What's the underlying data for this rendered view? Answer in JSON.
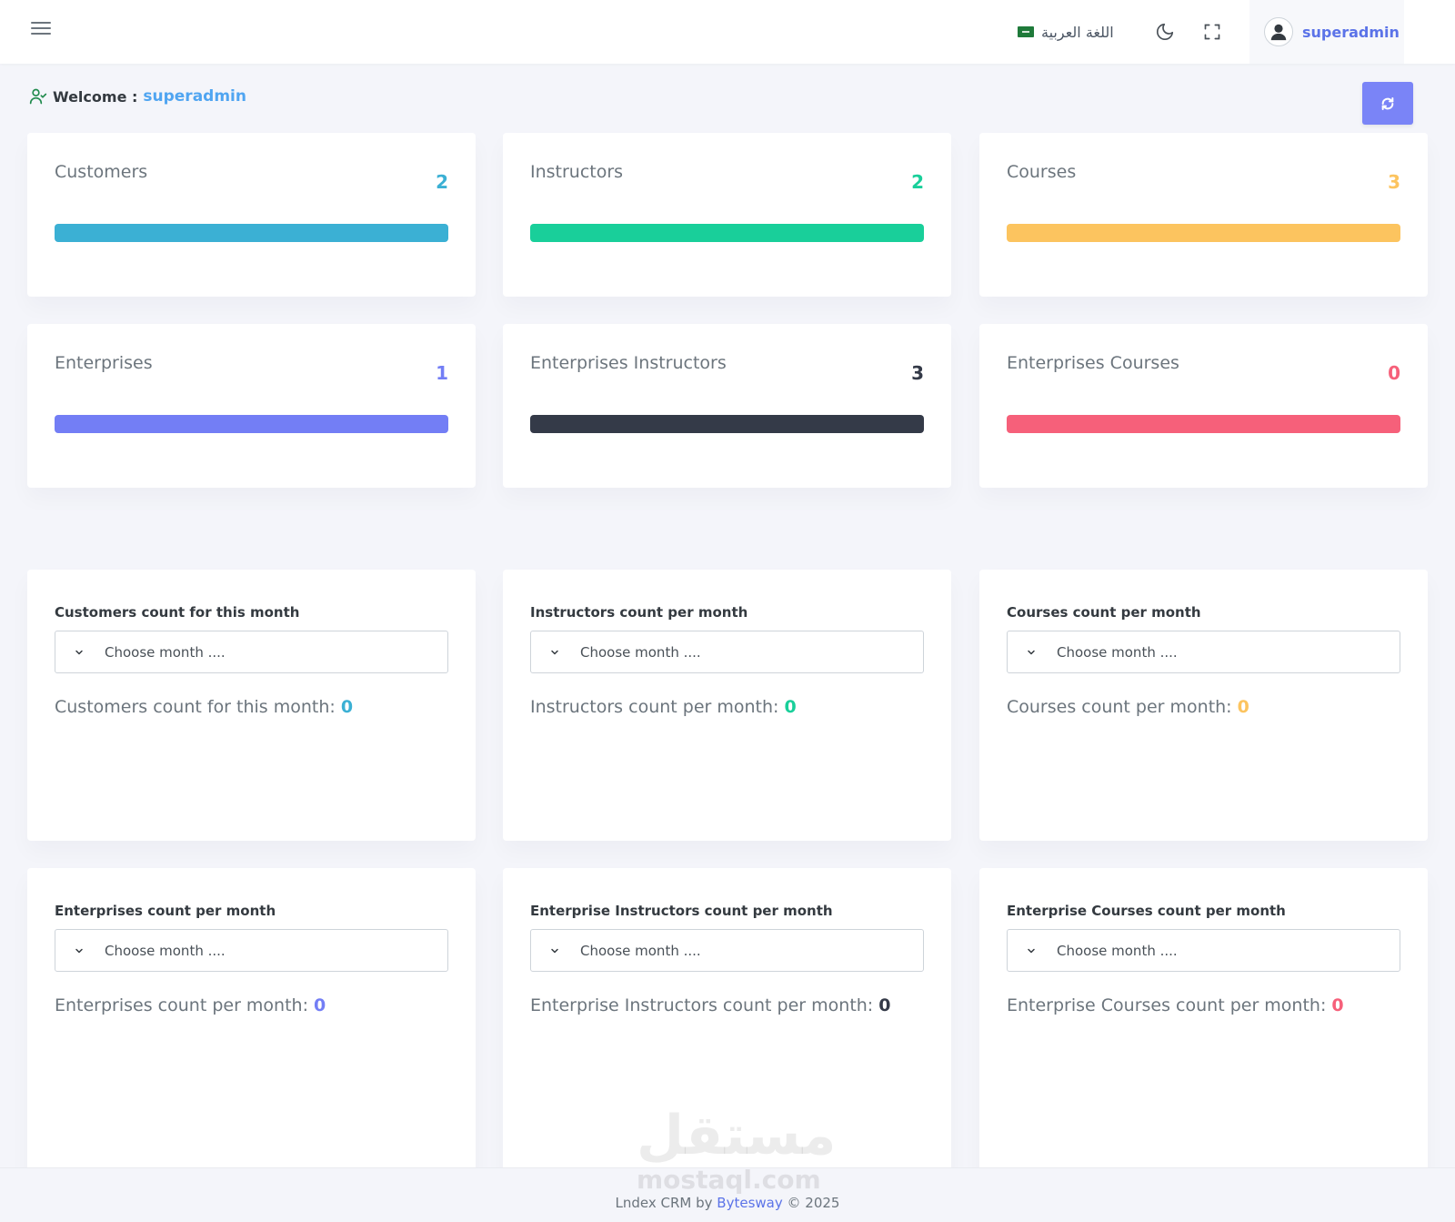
{
  "header": {
    "language_label": "اللغة العربية",
    "username": "superadmin"
  },
  "welcome": {
    "label": "Welcome :",
    "name": "superadmin"
  },
  "stats": [
    {
      "title": "Customers",
      "value": "2",
      "color": "#3bb0d4"
    },
    {
      "title": "Instructors",
      "value": "2",
      "color": "#19cf9a"
    },
    {
      "title": "Courses",
      "value": "3",
      "color": "#fcc45f"
    },
    {
      "title": "Enterprises",
      "value": "1",
      "color": "#737ef5"
    },
    {
      "title": "Enterprises Instructors",
      "value": "3",
      "color": "#343a48"
    },
    {
      "title": "Enterprises Courses",
      "value": "0",
      "color": "#f6607a"
    }
  ],
  "monthly": [
    {
      "title": "Customers count for this month",
      "placeholder": "Choose month ....",
      "result_label": "Customers count for this month:",
      "result_value": "0",
      "color": "#3bb0d4"
    },
    {
      "title": "Instructors count per month",
      "placeholder": "Choose month ....",
      "result_label": "Instructors count per month:",
      "result_value": "0",
      "color": "#19cf9a"
    },
    {
      "title": "Courses count per month",
      "placeholder": "Choose month ....",
      "result_label": "Courses count per month:",
      "result_value": "0",
      "color": "#fcc45f"
    },
    {
      "title": "Enterprises count per month",
      "placeholder": "Choose month ....",
      "result_label": "Enterprises count per month:",
      "result_value": "0",
      "color": "#737ef5"
    },
    {
      "title": "Enterprise Instructors count per month",
      "placeholder": "Choose month ....",
      "result_label": "Enterprise Instructors count per month:",
      "result_value": "0",
      "color": "#343a48"
    },
    {
      "title": "Enterprise Courses count per month",
      "placeholder": "Choose month ....",
      "result_label": "Enterprise Courses count per month:",
      "result_value": "0",
      "color": "#f6607a"
    }
  ],
  "footer": {
    "prefix": "Lndex CRM by",
    "brand": "Bytesway",
    "suffix": "© 2025"
  },
  "watermark": {
    "text": "مستقل",
    "sub": "mostaql.com"
  },
  "colors": {
    "accent": "#5b73e8",
    "refresh_button": "#7a84f7",
    "welcome_name": "#50a5f1"
  }
}
